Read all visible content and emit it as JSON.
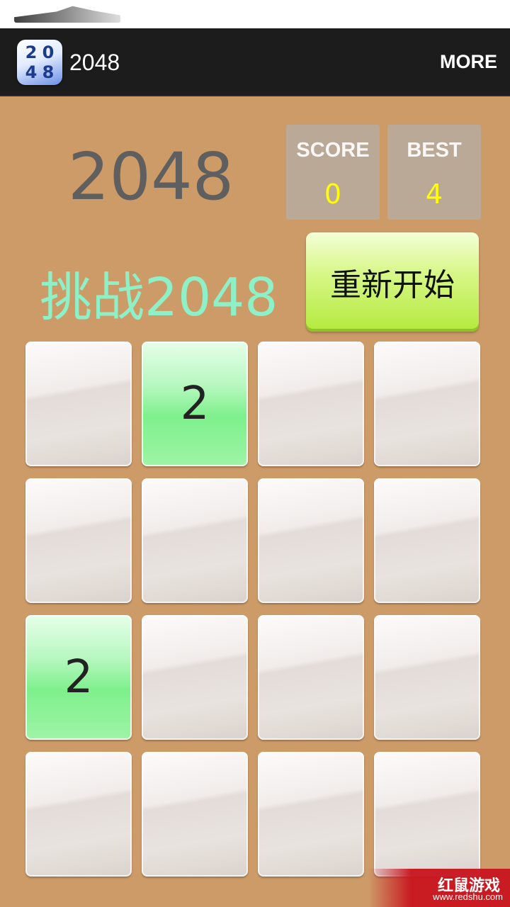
{
  "app_bar": {
    "icon_digits": [
      "2",
      "0",
      "4",
      "8"
    ],
    "title": "2048",
    "more_label": "MORE"
  },
  "header": {
    "game_title": "2048",
    "score_label": "SCORE",
    "score_value": "0",
    "best_label": "BEST",
    "best_value": "4",
    "challenge_label": "挑战2048",
    "restart_label": "重新开始"
  },
  "board": {
    "rows": [
      [
        "",
        "2",
        "",
        ""
      ],
      [
        "",
        "",
        "",
        ""
      ],
      [
        "2",
        "",
        "",
        ""
      ],
      [
        "",
        "",
        "",
        ""
      ]
    ]
  },
  "watermark": {
    "title": "红鼠游戏",
    "url": "www.redshu.com"
  },
  "colors": {
    "background": "#cd9b68",
    "action_bar": "#1c1c1c",
    "score_box": "#bba998",
    "score_value": "#ffff00",
    "challenge_text": "#8ef0c6",
    "restart_button": "#d8f78a",
    "filled_tile": "#7ef08c"
  }
}
